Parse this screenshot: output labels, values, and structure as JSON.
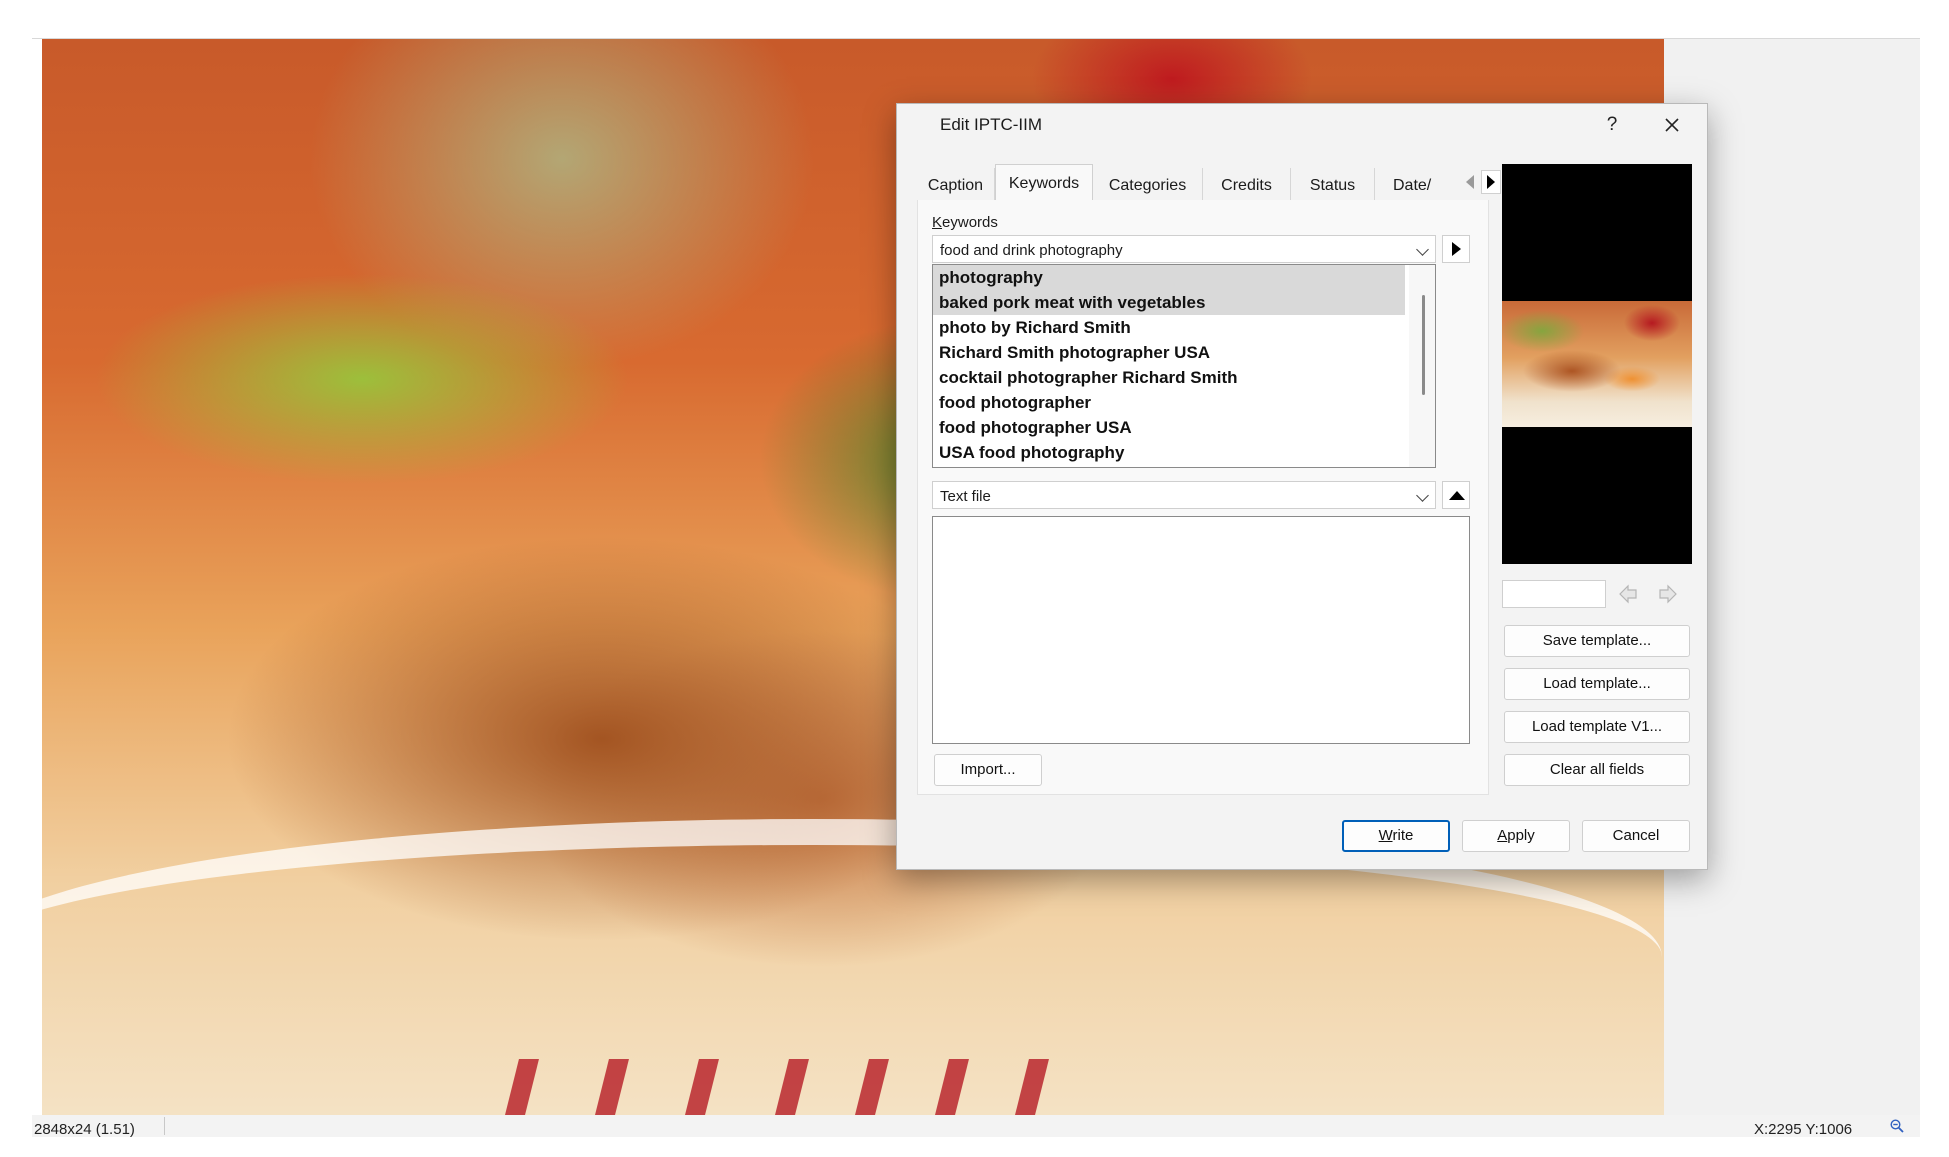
{
  "viewer": {
    "status_left": "2848x24 (1.51)",
    "status_right": "X:2295  Y:1006",
    "zoom_icon": "magnifier-zoom-out-icon"
  },
  "dialog": {
    "title": "Edit IPTC-IIM",
    "help_label": "?",
    "close_icon": "close-icon",
    "tabs": [
      {
        "label": "Caption"
      },
      {
        "label": "Keywords"
      },
      {
        "label": "Categories"
      },
      {
        "label": "Credits"
      },
      {
        "label": "Status"
      },
      {
        "label": "Date/"
      }
    ],
    "active_tab": "Keywords",
    "keywords": {
      "label_prefix": "K",
      "label_rest": "eywords",
      "input_value": "food and drink photography",
      "items": [
        {
          "text": "photography",
          "selected": true
        },
        {
          "text": "baked pork meat with vegetables",
          "selected": true
        },
        {
          "text": "photo by Richard Smith",
          "selected": false
        },
        {
          "text": "Richard Smith photographer USA",
          "selected": false
        },
        {
          "text": "cocktail photographer Richard Smith",
          "selected": false
        },
        {
          "text": "food photographer",
          "selected": false
        },
        {
          "text": "food photographer USA",
          "selected": false
        },
        {
          "text": "USA food photography",
          "selected": false
        }
      ],
      "source_select": "Text file",
      "import_button": "Import..."
    },
    "side_buttons": {
      "save_template": "Save template...",
      "load_template": "Load template...",
      "load_template_v1": "Load template V1...",
      "clear_all": "Clear all fields"
    },
    "footer": {
      "write_u": "W",
      "write_rest": "rite",
      "apply_u": "A",
      "apply_rest": "pply",
      "cancel": "Cancel"
    }
  }
}
